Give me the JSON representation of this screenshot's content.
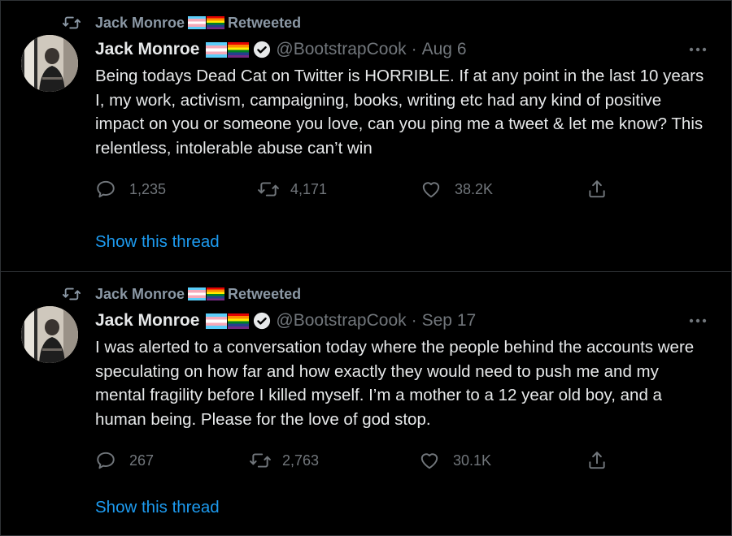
{
  "tweets": [
    {
      "retweet_by": "Jack Monroe",
      "retweet_label": "Retweeted",
      "author_name": "Jack Monroe",
      "handle": "@BootstrapCook",
      "dot": "·",
      "date": "Aug 6",
      "text": "Being todays Dead Cat on Twitter is HORRIBLE. If at any point in the last 10 years I, my work, activism, campaigning, books, writing etc had any kind of positive impact on you or someone you love, can you ping me a tweet & let me know? This relentless, intolerable abuse can’t win",
      "replies": "1,235",
      "retweets": "4,171",
      "likes": "38.2K",
      "thread_link": "Show this thread"
    },
    {
      "retweet_by": "Jack Monroe",
      "retweet_label": "Retweeted",
      "author_name": "Jack Monroe",
      "handle": "@BootstrapCook",
      "dot": "·",
      "date": "Sep 17",
      "text": "I was alerted to a conversation today where the people behind the accounts were speculating on how far and how exactly they would need to push me and my mental fragility before I killed myself. I’m a mother to a 12 year old boy, and a human being. Please for the love of god stop.",
      "replies": "267",
      "retweets": "2,763",
      "likes": "30.1K",
      "thread_link": "Show this thread"
    }
  ],
  "icons": {
    "retweet": "retweet-icon",
    "verified": "verified-badge-icon",
    "more": "more-options-icon",
    "reply": "reply-icon",
    "like": "heart-icon",
    "share": "share-icon",
    "flags": [
      "transgender-flag-icon",
      "rainbow-flag-icon"
    ]
  },
  "colors": {
    "background": "#000000",
    "text": "#e7e9ea",
    "muted": "#71767b",
    "link": "#1d9bf0",
    "border": "#2f3336"
  }
}
